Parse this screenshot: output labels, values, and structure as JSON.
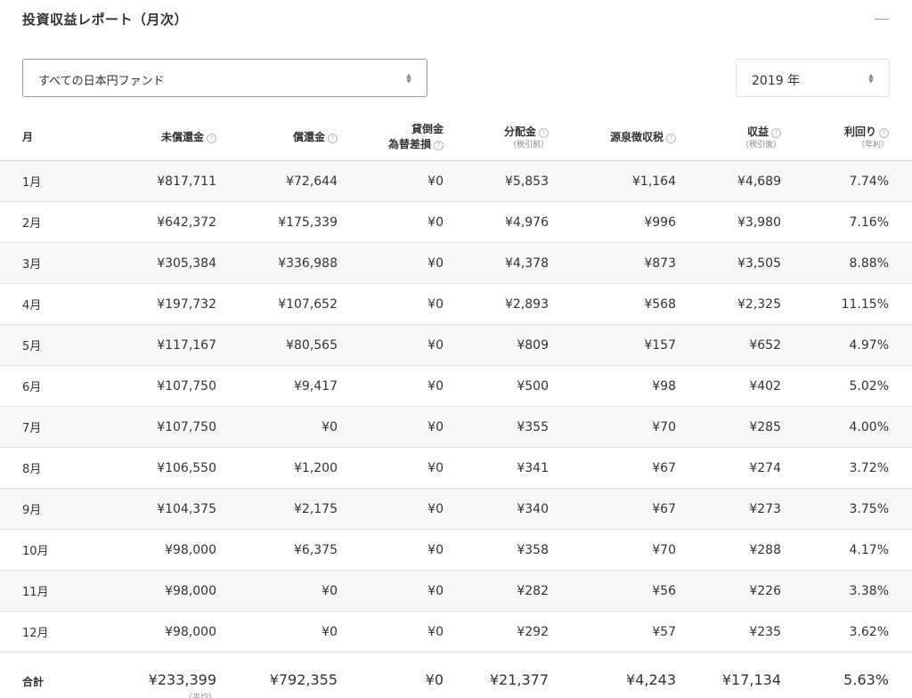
{
  "header": {
    "title": "投資収益レポート（月次）"
  },
  "filters": {
    "fund_select": "すべての日本円ファンド",
    "year_select": "2019 年"
  },
  "columns": [
    {
      "label": "月",
      "help": false,
      "sub": ""
    },
    {
      "label": "未償還金",
      "help": true,
      "sub": ""
    },
    {
      "label": "償還金",
      "help": true,
      "sub": ""
    },
    {
      "label": "貸倒金",
      "label2": "為替差損",
      "help": true,
      "sub": ""
    },
    {
      "label": "分配金",
      "help": true,
      "sub": "（税引前）"
    },
    {
      "label": "源泉徴収税",
      "help": true,
      "sub": ""
    },
    {
      "label": "収益",
      "help": true,
      "sub": "（税引後）"
    },
    {
      "label": "利回り",
      "help": true,
      "sub": "（年利）"
    }
  ],
  "rows": [
    [
      "1月",
      "¥817,711",
      "¥72,644",
      "¥0",
      "¥5,853",
      "¥1,164",
      "¥4,689",
      "7.74%"
    ],
    [
      "2月",
      "¥642,372",
      "¥175,339",
      "¥0",
      "¥4,976",
      "¥996",
      "¥3,980",
      "7.16%"
    ],
    [
      "3月",
      "¥305,384",
      "¥336,988",
      "¥0",
      "¥4,378",
      "¥873",
      "¥3,505",
      "8.88%"
    ],
    [
      "4月",
      "¥197,732",
      "¥107,652",
      "¥0",
      "¥2,893",
      "¥568",
      "¥2,325",
      "11.15%"
    ],
    [
      "5月",
      "¥117,167",
      "¥80,565",
      "¥0",
      "¥809",
      "¥157",
      "¥652",
      "4.97%"
    ],
    [
      "6月",
      "¥107,750",
      "¥9,417",
      "¥0",
      "¥500",
      "¥98",
      "¥402",
      "5.02%"
    ],
    [
      "7月",
      "¥107,750",
      "¥0",
      "¥0",
      "¥355",
      "¥70",
      "¥285",
      "4.00%"
    ],
    [
      "8月",
      "¥106,550",
      "¥1,200",
      "¥0",
      "¥341",
      "¥67",
      "¥274",
      "3.72%"
    ],
    [
      "9月",
      "¥104,375",
      "¥2,175",
      "¥0",
      "¥340",
      "¥67",
      "¥273",
      "3.75%"
    ],
    [
      "10月",
      "¥98,000",
      "¥6,375",
      "¥0",
      "¥358",
      "¥70",
      "¥288",
      "4.17%"
    ],
    [
      "11月",
      "¥98,000",
      "¥0",
      "¥0",
      "¥282",
      "¥56",
      "¥226",
      "3.38%"
    ],
    [
      "12月",
      "¥98,000",
      "¥0",
      "¥0",
      "¥292",
      "¥57",
      "¥235",
      "3.62%"
    ]
  ],
  "total": {
    "label": "合計",
    "values": [
      "¥233,399",
      "¥792,355",
      "¥0",
      "¥21,377",
      "¥4,243",
      "¥17,134",
      "5.63%"
    ],
    "note": "（平均）"
  },
  "icons": {
    "help": "question-circle-icon",
    "select_arrows": "updown-arrows-icon",
    "collapse": "minus-icon"
  }
}
